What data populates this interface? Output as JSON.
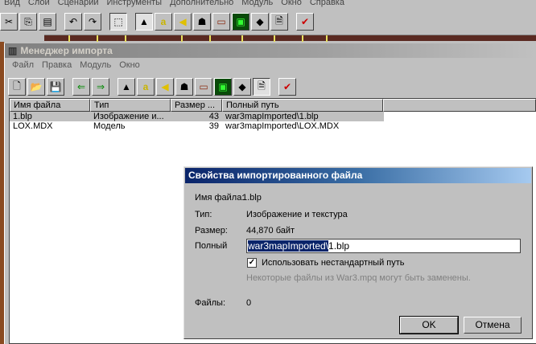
{
  "main_menu": [
    "Вид",
    "Слой",
    "Сценарий",
    "Инструменты",
    "Дополнительно",
    "Модуль",
    "Окно",
    "Справка"
  ],
  "window": {
    "title": "Менеджер импорта",
    "menu": [
      "Файл",
      "Правка",
      "Модуль",
      "Окно"
    ]
  },
  "list": {
    "columns": [
      "Имя файла",
      "Тип",
      "Размер ...",
      "Полный путь"
    ],
    "rows": [
      {
        "name": "1.blp",
        "type": "Изображение и...",
        "size": "43",
        "path": "war3mapImported\\1.blp"
      },
      {
        "name": "LOX.MDX",
        "type": "Модель",
        "size": "39",
        "path": "war3mapImported\\LOX.MDX"
      }
    ]
  },
  "dialog": {
    "title": "Свойства импортированного файла",
    "name_label": "Имя файла:",
    "name_value": "1.blp",
    "type_label": "Тип:",
    "type_value": "Изображение и текстура",
    "size_label": "Размер:",
    "size_value": "44,870 байт",
    "path_label": "Полный",
    "path_selected": "war3mapImported\\",
    "path_rest": "1.blp",
    "checkbox_label": "Использовать нестандартный путь",
    "checkbox_checked": true,
    "note": "Некоторые файлы из War3.mpq могут быть заменены.",
    "files_label": "Файлы:",
    "files_value": "0",
    "ok": "OK",
    "cancel": "Отмена"
  }
}
